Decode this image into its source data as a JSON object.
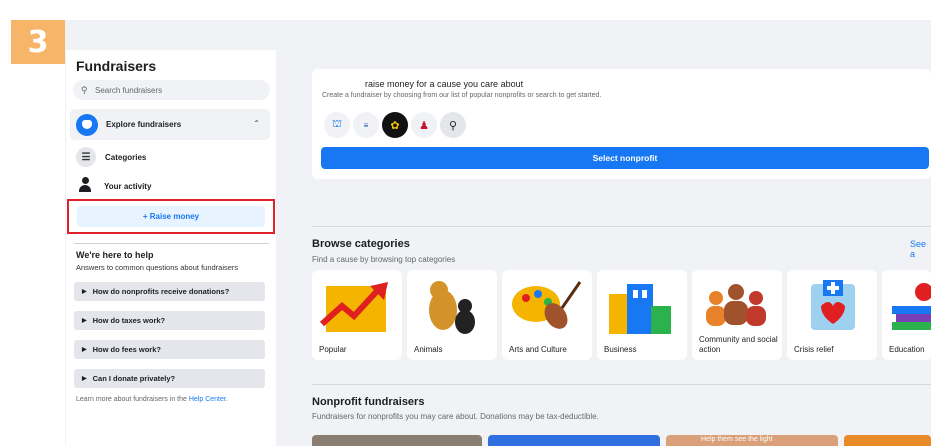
{
  "step": "3",
  "sidebar": {
    "title": "Fundraisers",
    "search_placeholder": "Search fundraisers",
    "explore_label": "Explore fundraisers",
    "categories_label": "Categories",
    "activity_label": "Your activity",
    "raise_label": "+ Raise money",
    "help_title": "We're here to help",
    "help_sub": "Answers to common questions about fundraisers",
    "faq": [
      "How do nonprofits receive donations?",
      "How do taxes work?",
      "How do fees work?",
      "Can I donate privately?"
    ],
    "learn_prefix": "Learn more about fundraisers in the",
    "help_center": "Help Center",
    "learn_suffix": "."
  },
  "card": {
    "title": "raise money for a cause you care about",
    "subtitle": "Create a fundraiser by choosing from our list of popular nonprofits or search to get started.",
    "select_label": "Select nonprofit"
  },
  "browse": {
    "title": "Browse categories",
    "subtitle": "Find a cause by browsing top categories",
    "see_all": "See a",
    "categories": [
      "Popular",
      "Animals",
      "Arts and Culture",
      "Business",
      "Community and social action",
      "Crisis relief",
      "Education"
    ]
  },
  "nonprofit": {
    "title": "Nonprofit fundraisers",
    "subtitle": "Fundraisers for nonprofits you may care about. Donations may be tax-deductible.",
    "thumb_text": "Help them see the light"
  },
  "colors": {
    "accent": "#1877f2",
    "highlight": "#e0202a",
    "badge": "#f7b56a"
  }
}
